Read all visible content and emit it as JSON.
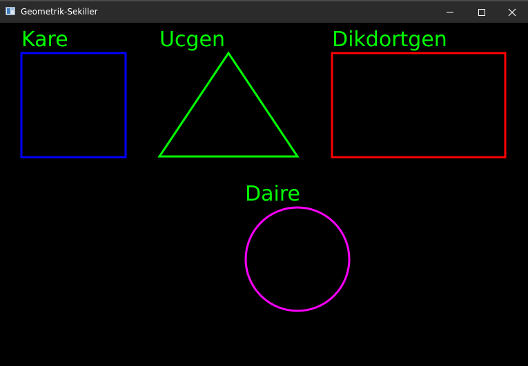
{
  "window": {
    "title": "Geometrik-Sekiller",
    "controls": {
      "minimize_icon": "minimize-icon",
      "maximize_icon": "maximize-icon",
      "close_icon": "close-icon"
    }
  },
  "canvas": {
    "background": "#000000",
    "shapes": {
      "square": {
        "label": "Kare",
        "color": "#0000ff"
      },
      "triangle": {
        "label": "Ucgen",
        "color": "#00ff00"
      },
      "rectangle": {
        "label": "Dikdortgen",
        "color": "#ff0000"
      },
      "circle": {
        "label": "Daire",
        "color": "#ff00ff"
      }
    },
    "label_color": "#00ff00"
  }
}
